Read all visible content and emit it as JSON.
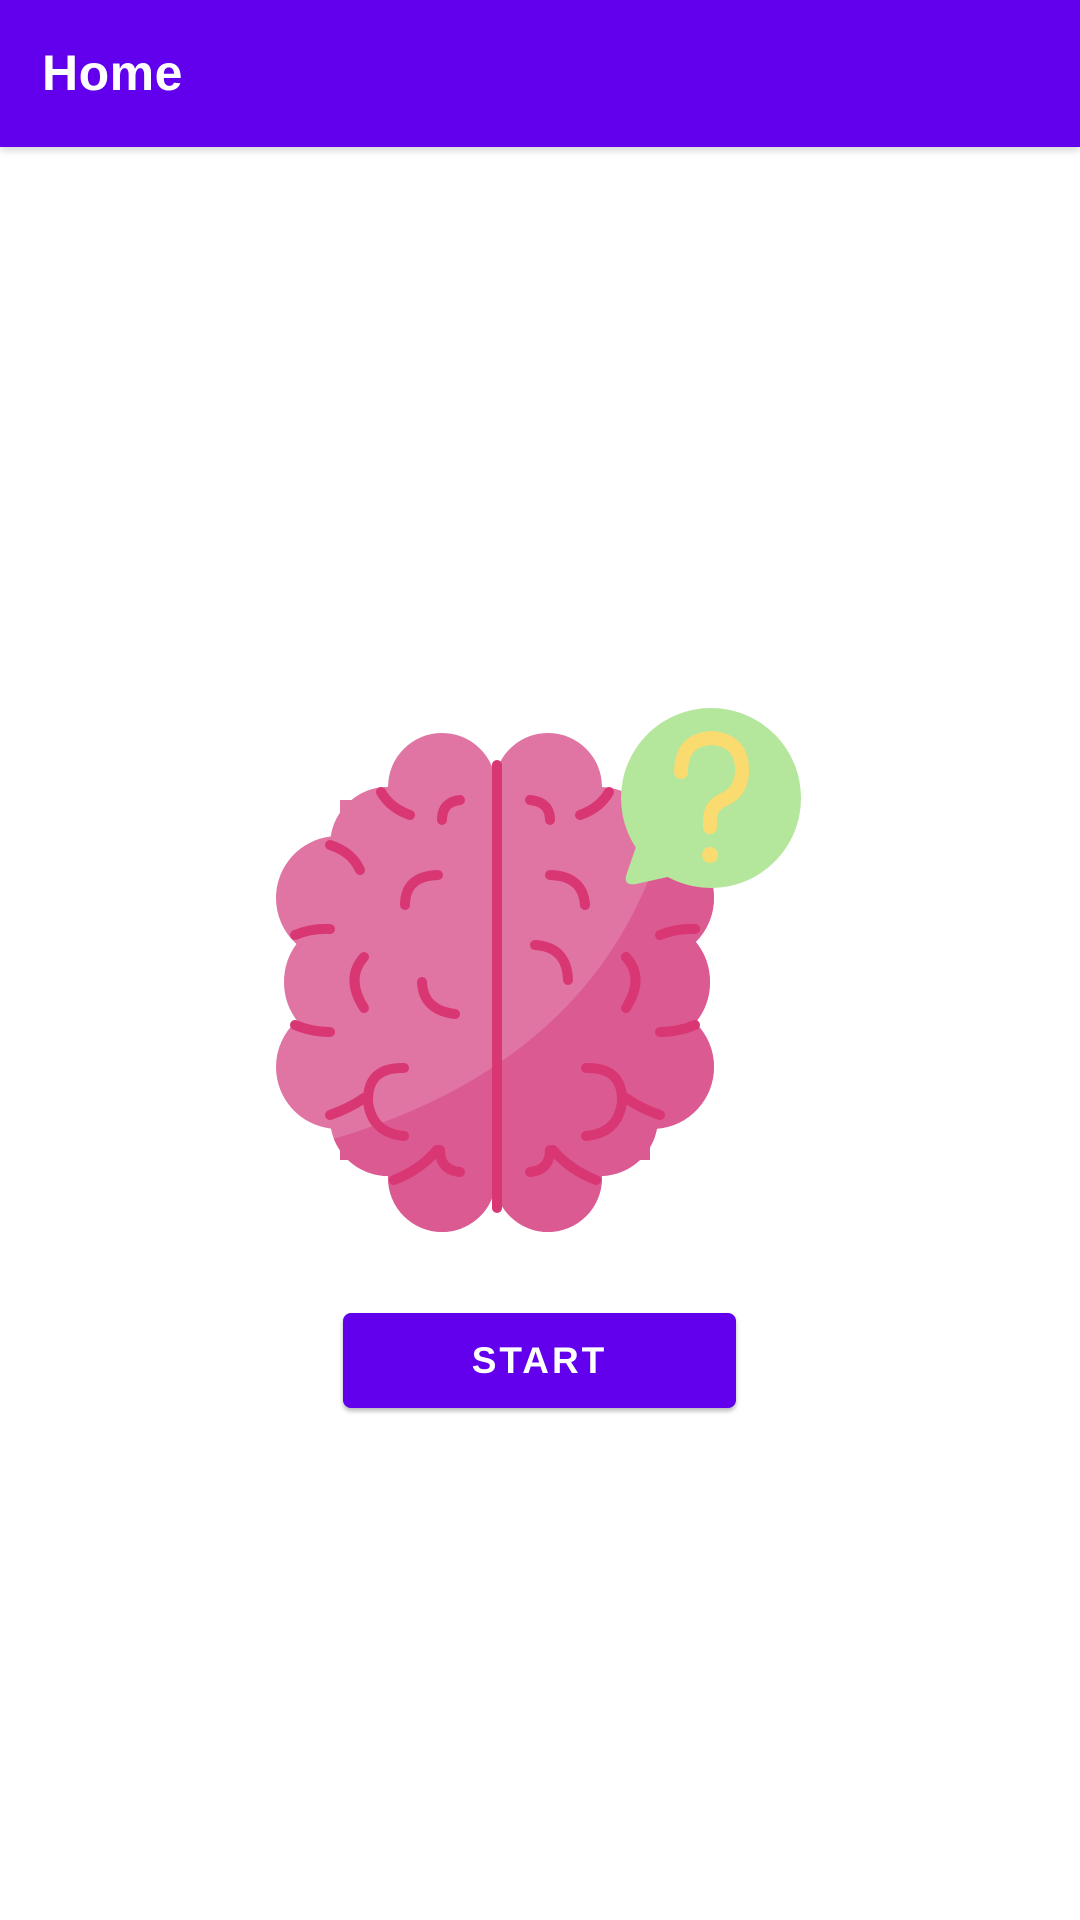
{
  "app_bar": {
    "title": "Home",
    "background_color": "#6200EE"
  },
  "illustration": {
    "icon": "brain-question-icon",
    "colors": {
      "brain_light": "#E075A4",
      "brain_dark": "#DB5A92",
      "brain_lines": "#D93674",
      "bubble": "#B4E69C",
      "question_mark": "#FADB70"
    }
  },
  "start_button": {
    "label": "START",
    "color": "#6200EE"
  }
}
